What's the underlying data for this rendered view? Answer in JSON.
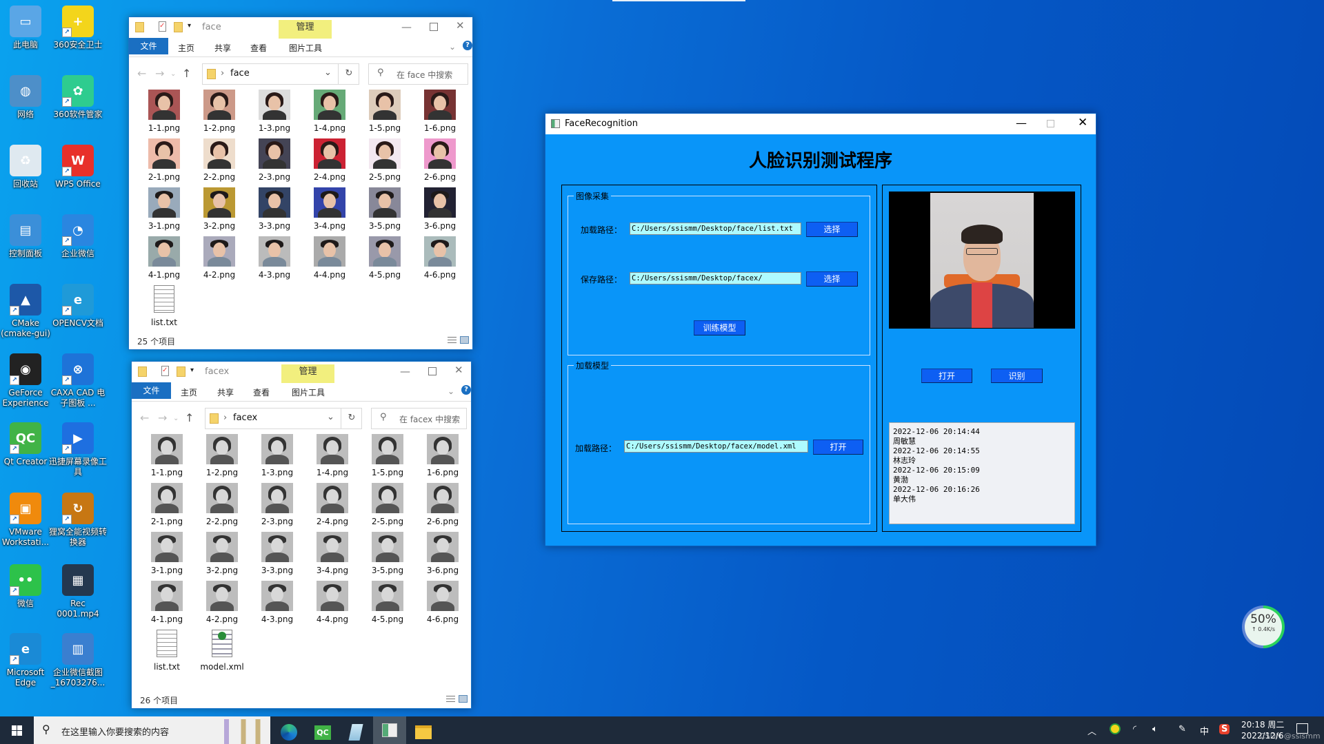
{
  "desktop_icons": [
    {
      "label": "此电脑",
      "icon": "computer-icon",
      "color": "#5aa6e6",
      "glyph": "▭"
    },
    {
      "label": "360安全卫士",
      "icon": "360-security-icon",
      "color": "#f3d51b",
      "glyph": "+"
    },
    {
      "label": "网络",
      "icon": "network-icon",
      "color": "#4d8fc9",
      "glyph": "◍"
    },
    {
      "label": "360软件管家",
      "icon": "360-software-icon",
      "color": "#2ecc8f",
      "glyph": "✿"
    },
    {
      "label": "回收站",
      "icon": "recycle-bin-icon",
      "color": "#dfe9f0",
      "glyph": "♻"
    },
    {
      "label": "WPS Office",
      "icon": "wps-icon",
      "color": "#e8302a",
      "glyph": "W"
    },
    {
      "label": "控制面板",
      "icon": "control-panel-icon",
      "color": "#3b8fd9",
      "glyph": "▤"
    },
    {
      "label": "企业微信",
      "icon": "wecom-icon",
      "color": "#2a86e0",
      "glyph": "◔"
    },
    {
      "label": "CMake (cmake-gui)",
      "icon": "cmake-icon",
      "color": "#1d58a8",
      "glyph": "▲"
    },
    {
      "label": "OPENCV文档",
      "icon": "edge-icon",
      "color": "#1f9ad8",
      "glyph": "e"
    },
    {
      "label": "GeForce Experience",
      "icon": "geforce-icon",
      "color": "#222",
      "glyph": "◉"
    },
    {
      "label": "CAXA CAD 电子图板 ...",
      "icon": "caxa-icon",
      "color": "#1e73d8",
      "glyph": "⊗"
    },
    {
      "label": "Qt Creator",
      "icon": "qt-creator-icon",
      "color": "#41b346",
      "glyph": "QC"
    },
    {
      "label": "迅捷屏幕录像工具",
      "icon": "screen-recorder-icon",
      "color": "#1e6fe0",
      "glyph": "▶"
    },
    {
      "label": "VMware Workstati...",
      "icon": "vmware-icon",
      "color": "#f08a0c",
      "glyph": "▣"
    },
    {
      "label": "狸窝全能视频转换器",
      "icon": "video-converter-icon",
      "color": "#c77713",
      "glyph": "↻"
    },
    {
      "label": "微信",
      "icon": "wechat-icon",
      "color": "#2dc24a",
      "glyph": "••"
    },
    {
      "label": "Rec 0001.mp4",
      "icon": "video-file-icon",
      "color": "#24384f",
      "glyph": "▦"
    },
    {
      "label": "Microsoft Edge",
      "icon": "edge-icon",
      "color": "#1a8ad6",
      "glyph": "e"
    },
    {
      "label": "企业微信截图_16703276...",
      "icon": "image-file-icon",
      "color": "#3a7fd0",
      "glyph": "▥"
    }
  ],
  "explorer1": {
    "title": "face",
    "manage_tab": "管理",
    "tabs": [
      "文件",
      "主页",
      "共享",
      "查看",
      "图片工具"
    ],
    "address": "face",
    "search_placeholder": "在 face 中搜索",
    "status": "25 个项目",
    "files": [
      "1-1.png",
      "1-2.png",
      "1-3.png",
      "1-4.png",
      "1-5.png",
      "1-6.png",
      "2-1.png",
      "2-2.png",
      "2-3.png",
      "2-4.png",
      "2-5.png",
      "2-6.png",
      "3-1.png",
      "3-2.png",
      "3-3.png",
      "3-4.png",
      "3-5.png",
      "3-6.png",
      "4-1.png",
      "4-2.png",
      "4-3.png",
      "4-4.png",
      "4-5.png",
      "4-6.png",
      "list.txt"
    ]
  },
  "explorer2": {
    "title": "facex",
    "manage_tab": "管理",
    "tabs": [
      "文件",
      "主页",
      "共享",
      "查看",
      "图片工具"
    ],
    "address": "facex",
    "search_placeholder": "在 facex 中搜索",
    "status": "26 个项目",
    "files": [
      "1-1.png",
      "1-2.png",
      "1-3.png",
      "1-4.png",
      "1-5.png",
      "1-6.png",
      "2-1.png",
      "2-2.png",
      "2-3.png",
      "2-4.png",
      "2-5.png",
      "2-6.png",
      "3-1.png",
      "3-2.png",
      "3-3.png",
      "3-4.png",
      "3-5.png",
      "3-6.png",
      "4-1.png",
      "4-2.png",
      "4-3.png",
      "4-4.png",
      "4-5.png",
      "4-6.png",
      "list.txt",
      "model.xml"
    ]
  },
  "app": {
    "window_title": "FaceRecognition",
    "heading": "人脸识别测试程序",
    "capture_group": {
      "title": "图像采集",
      "load_label": "加载路径：",
      "load_value": "C:/Users/ssismm/Desktop/face/list.txt",
      "load_button": "选择",
      "save_label": "保存路径：",
      "save_value": "C:/Users/ssismm/Desktop/facex/",
      "save_button": "选择",
      "train_button": "训练模型"
    },
    "model_group": {
      "title": "加载模型",
      "load_label": "加载路径：",
      "load_value": "C:/Users/ssismm/Desktop/facex/model.xml",
      "open_button": "打开"
    },
    "open_button": "打开",
    "recognize_button": "识别",
    "log": [
      "2022-12-06 20:14:44",
      "周敏慧",
      "2022-12-06 20:14:55",
      "林志玲",
      "2022-12-06 20:15:09",
      "黄渤",
      "2022-12-06 20:16:26",
      "单大伟"
    ]
  },
  "widget": {
    "percent": "50%",
    "percent_value": 50,
    "speed": "↑ 0.4K/s"
  },
  "taskbar": {
    "search_placeholder": "在这里输入你要搜索的内容",
    "ime": "中",
    "time": "20:18 周二",
    "date": "2022/12/6",
    "watermark": "CSDN @ssismm"
  },
  "colors": {
    "app_bg": "#0995f9",
    "app_button": "#0d5ff3",
    "path_input": "#aefbff",
    "manage_tab": "#f2ef7e",
    "ribbon_file": "#1a6fc2"
  }
}
